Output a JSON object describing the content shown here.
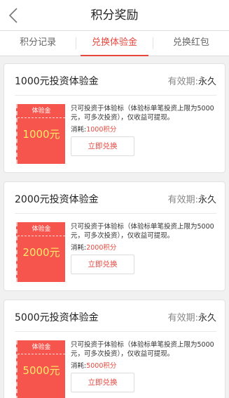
{
  "header": {
    "title": "积分奖励",
    "back_icon": "chevron-left-icon"
  },
  "tabs": [
    {
      "label": "积分记录",
      "active": false
    },
    {
      "label": "兑换体验金",
      "active": true
    },
    {
      "label": "兑换红包",
      "active": false
    }
  ],
  "cards": [
    {
      "name": "1000元投资体验金",
      "validity_label": "有效期:",
      "validity_value": "永久",
      "coupon_header": "体验金",
      "coupon_amount": "1000元",
      "description": "只可投资于体验标（体验标单笔投资上限为5000元，可多次投资），仅收益可提现。",
      "cost_label": "消耗:",
      "cost_value": "1000积分",
      "button_label": "立即兑换"
    },
    {
      "name": "2000元投资体验金",
      "validity_label": "有效期:",
      "validity_value": "永久",
      "coupon_header": "体验金",
      "coupon_amount": "2000元",
      "description": "只可投资于体验标（体验标单笔投资上限为5000元，可多次投资），仅收益可提现。",
      "cost_label": "消耗:",
      "cost_value": "2000积分",
      "button_label": "立即兑换"
    },
    {
      "name": "5000元投资体验金",
      "validity_label": "有效期:",
      "validity_value": "永久",
      "coupon_header": "体验金",
      "coupon_amount": "5000元",
      "description": "只可投资于体验标（体验标单笔投资上限为5000元，可多次投资），仅收益可提现。",
      "cost_label": "消耗:",
      "cost_value": "5000积分",
      "button_label": "立即兑换"
    }
  ],
  "colors": {
    "accent": "#e8473e",
    "coupon_bg": "#f5554d",
    "coupon_amount": "#ffe86a"
  }
}
